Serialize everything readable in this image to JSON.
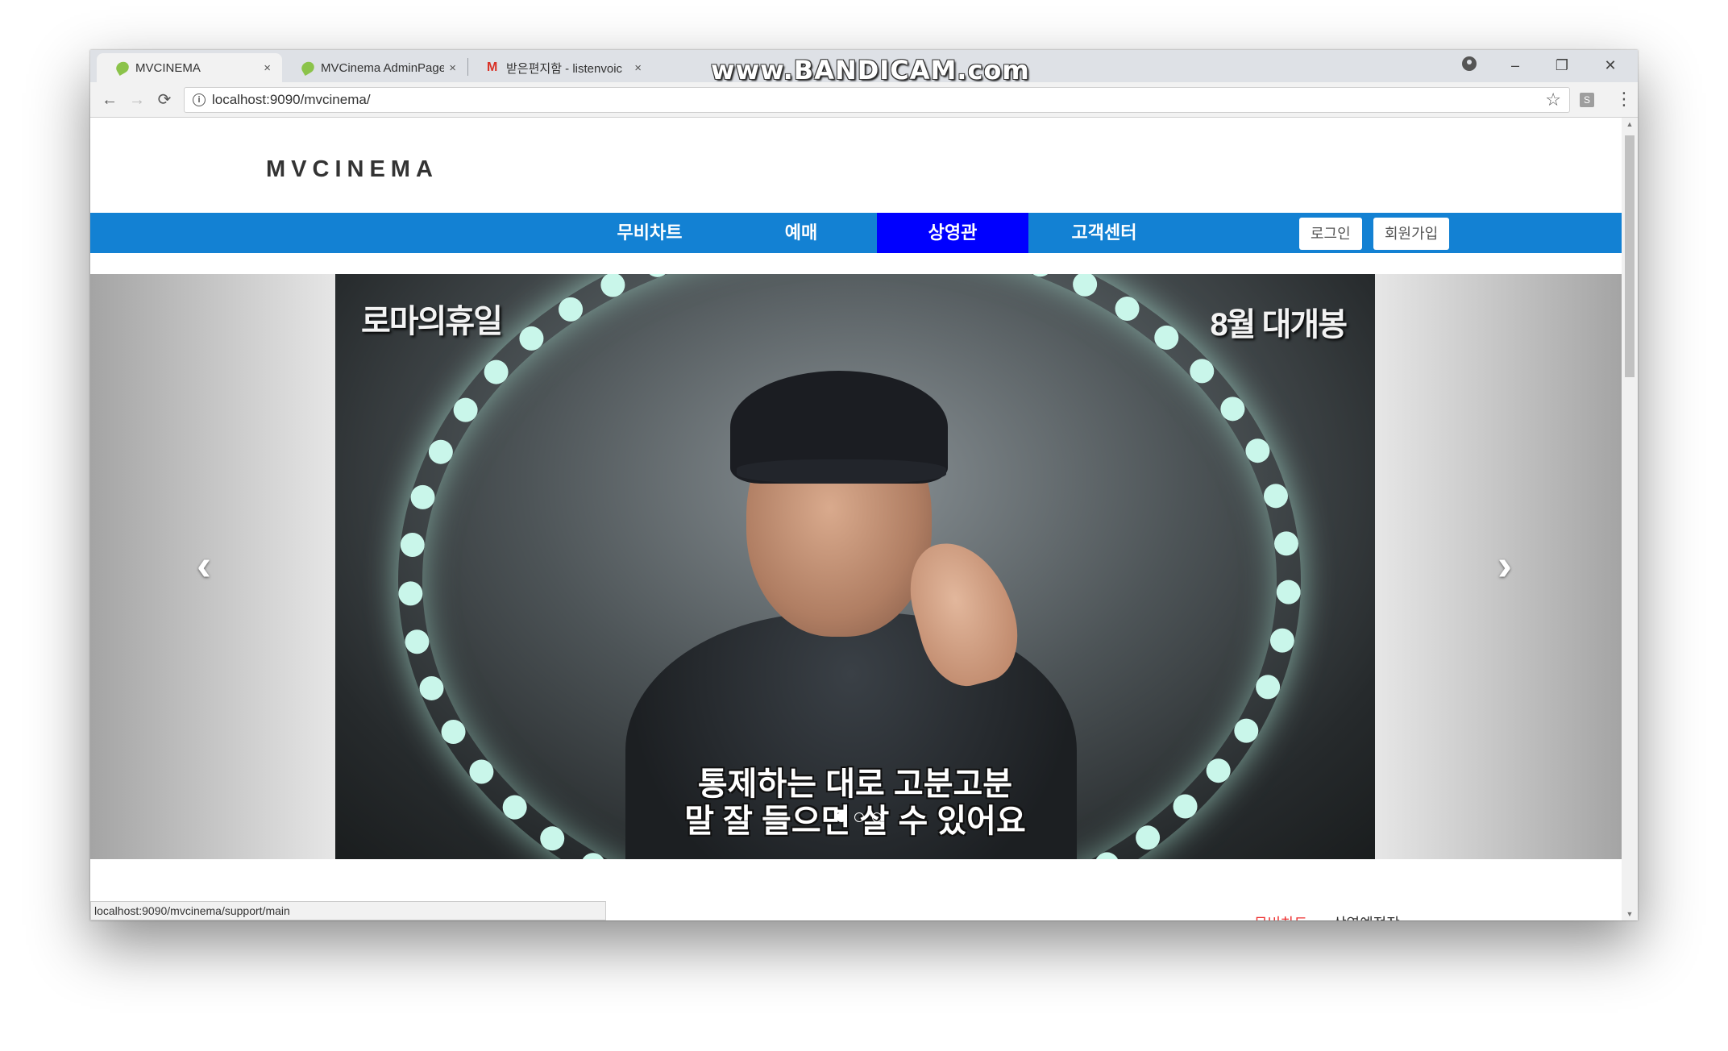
{
  "browser": {
    "tabs": [
      {
        "title": "MVCINEMA",
        "close": "×"
      },
      {
        "title": "MVCinema AdminPage",
        "close": "×"
      },
      {
        "title": "받은편지함 - listenvoic",
        "close": "×"
      }
    ],
    "watermark": "www.BANDICAM.com",
    "window_controls": {
      "minimize": "–",
      "restore": "❐",
      "close": "✕"
    },
    "nav": {
      "back": "←",
      "forward": "→",
      "reload": "⟳"
    },
    "url": "localhost:9090/mvcinema/",
    "status_url": "localhost:9090/mvcinema/support/main"
  },
  "site": {
    "logo": "MVCINEMA",
    "menu": [
      {
        "label": "무비차트"
      },
      {
        "label": "예매"
      },
      {
        "label": "상영관"
      },
      {
        "label": "고객센터"
      }
    ],
    "auth": {
      "login": "로그인",
      "signup": "회원가입"
    }
  },
  "carousel": {
    "poster_title": "로마의휴일",
    "poster_date": "8월 대개봉",
    "subtitle_line1": "통제하는 대로 고분고분",
    "subtitle_line2": "말 잘 들으면 살 수 있어요",
    "prev": "‹",
    "next": "›",
    "active_index": 0,
    "slide_count": 3
  },
  "section": {
    "title": "무비차트",
    "tabs": [
      {
        "label": "무비차트"
      },
      {
        "label": "상영예정작"
      }
    ]
  },
  "colors": {
    "nav_bar": "#1381d3",
    "nav_active": "#0000ff",
    "tab_active_text": "#ee3333"
  }
}
